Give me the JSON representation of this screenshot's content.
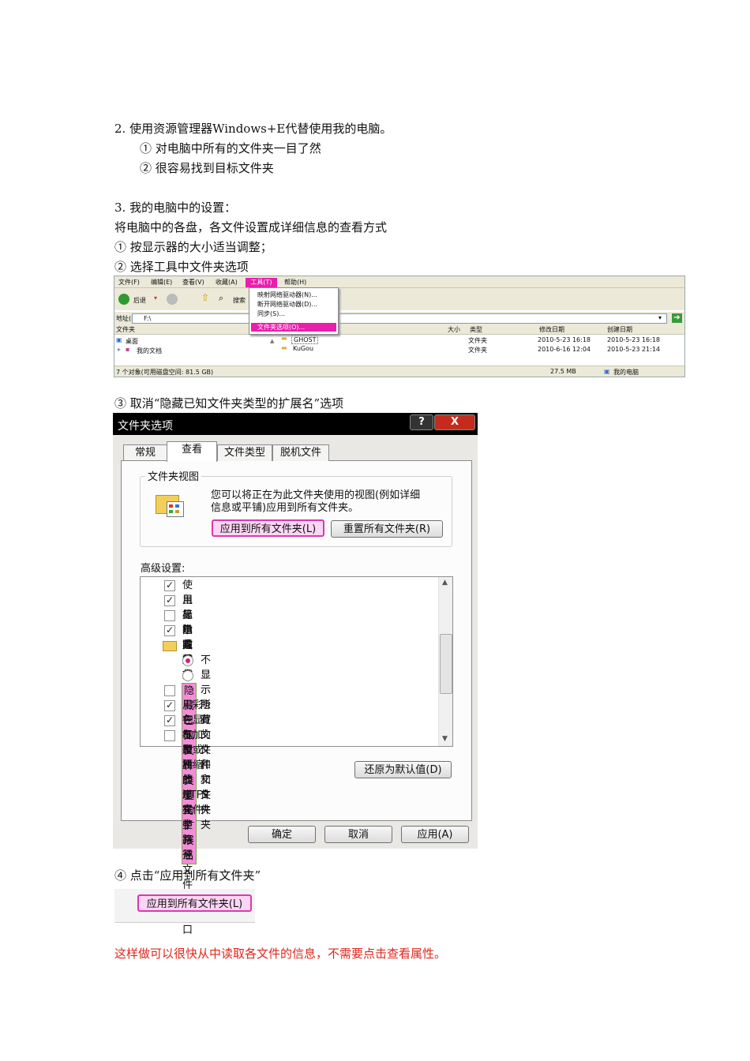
{
  "doc": {
    "line1": "2. 使用资源管理器Windows+E代替使用我的电脑。",
    "line2": "① 对电脑中所有的文件夹一目了然",
    "line3": "② 很容易找到目标文件夹",
    "line4": "3. 我的电脑中的设置：",
    "line5": "将电脑中的各盘，各文件设置成详细信息的查看方式",
    "line6": "①  按显示器的大小适当调整；",
    "line7": "②  选择工具中文件夹选项",
    "line8": "③ 取消“隐藏已知文件夹类型的扩展名”选项",
    "line9": "④  点击“应用到所有文件夹”",
    "footer": "这样做可以很快从中读取各文件的信息，不需要点击查看属性。"
  },
  "explorer": {
    "menu": [
      "文件(F)",
      "编辑(E)",
      "查看(V)",
      "收藏(A)",
      "工具(T)",
      "帮助(H)"
    ],
    "back_label": "后退",
    "search_label": "搜索",
    "address_label": "地址(D)",
    "address_value": "F:\\",
    "tools_menu": [
      "映射网络驱动器(N)...",
      "断开网络驱动器(D)...",
      "同步(S)...",
      "文件夹选项(O)..."
    ],
    "left_header": "文件夹",
    "tree": [
      "桌面",
      "我的文档"
    ],
    "columns": [
      "大小",
      "类型",
      "修改日期",
      "创建日期"
    ],
    "rows": [
      {
        "name": "GHOST",
        "type": "文件夹",
        "modified": "2010-5-23 16:18",
        "created": "2010-5-23 16:18"
      },
      {
        "name": "KuGou",
        "type": "文件夹",
        "modified": "2010-6-16 12:04",
        "created": "2010-5-23 21:14"
      }
    ],
    "status_left": "7 个对象(可用磁盘空间: 81.5 GB)",
    "status_size": "27.5 MB",
    "status_location": "我的电脑"
  },
  "dialog": {
    "title": "文件夹选项",
    "help_btn": "?",
    "close_btn": "X",
    "tabs": [
      "常规",
      "查看",
      "文件类型",
      "脱机文件"
    ],
    "folder_view_label": "文件夹视图",
    "folder_view_desc1": "您可以将正在为此文件夹使用的视图(例如详细",
    "folder_view_desc2": "信息或平铺)应用到所有文件夹。",
    "apply_all_btn": "应用到所有文件夹(L)",
    "reset_all_btn": "重置所有文件夹(R)",
    "advanced_label": "高级设置:",
    "settings": [
      {
        "label": "使用简单文件共享 (推荐)",
        "kind": "check",
        "checked": true
      },
      {
        "label": "鼠标指向文件夹和桌面项时显示提示信息",
        "kind": "check",
        "checked": true
      },
      {
        "label": "显示系统文件夹的内容",
        "kind": "check",
        "checked": false
      },
      {
        "label": "隐藏受保护的操作系统文件(推荐)",
        "kind": "check",
        "checked": true
      },
      {
        "label": "隐藏文件和文件夹",
        "kind": "folder",
        "checked": false
      },
      {
        "label": "不显示隐藏的文件和文件夹",
        "kind": "radio",
        "checked": true
      },
      {
        "label": "显示所有文件和文件夹",
        "kind": "radio",
        "checked": false
      },
      {
        "label": "隐藏已知文件类型的扩展名",
        "kind": "check",
        "checked": false
      },
      {
        "label": "用彩色显示加密或压缩的 NTFS 文件",
        "kind": "check",
        "checked": true
      },
      {
        "label": "在标题栏显示完整路径",
        "kind": "check",
        "checked": true
      },
      {
        "label": "在单独的进程中打开文件夹窗口",
        "kind": "check",
        "checked": false
      }
    ],
    "restore_btn": "还原为默认值(D)",
    "ok_btn": "确定",
    "cancel_btn": "取消",
    "apply_btn": "应用(A)"
  },
  "crop": {
    "apply_all_btn": "应用到所有文件夹(L)"
  },
  "colors": {
    "highlight": "#e91eac",
    "footer_text": "#e0261c"
  }
}
